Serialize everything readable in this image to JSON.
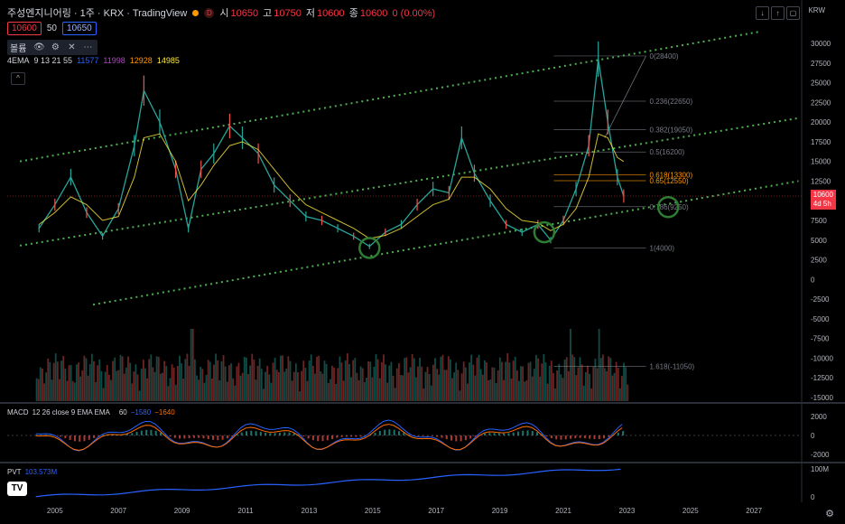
{
  "header": {
    "title": "주성엔지니어링 · 1주 · KRX · TradingView",
    "badge": "D",
    "ohlc": [
      {
        "label": "시",
        "value": "10650"
      },
      {
        "label": "고",
        "value": "10750"
      },
      {
        "label": "저",
        "value": "10600"
      },
      {
        "label": "종",
        "value": "10600"
      }
    ],
    "change": "0 (0.00%)"
  },
  "trade": {
    "sell": "10600",
    "spread": "50",
    "buy": "10650"
  },
  "toolbar": {
    "label": "볼륨"
  },
  "ema": {
    "name": "4EMA",
    "params": "9 13 21 55",
    "values": [
      {
        "v": "11577",
        "color": "#2962ff"
      },
      {
        "v": "11998",
        "color": "#ab47bc"
      },
      {
        "v": "12928",
        "color": "#ff9800"
      },
      {
        "v": "14985",
        "color": "#ffeb3b"
      }
    ]
  },
  "currency": "KRW",
  "price_tag": {
    "price": "10600",
    "time": "4d 5h"
  },
  "y_axis": [
    "30000",
    "27500",
    "25000",
    "22500",
    "20000",
    "17500",
    "15000",
    "12500",
    "10000",
    "7500",
    "5000",
    "2500",
    "0",
    "-2500",
    "-5000",
    "-7500",
    "-10000",
    "-12500",
    "-15000"
  ],
  "fib_levels": [
    {
      "label": "0(28400)",
      "color": "#787b86"
    },
    {
      "label": "0.236(22650)",
      "color": "#787b86"
    },
    {
      "label": "0.382(19050)",
      "color": "#787b86"
    },
    {
      "label": "0.5(16200)",
      "color": "#787b86"
    },
    {
      "label": "0.618(13300)",
      "color": "#ff9800"
    },
    {
      "label": "0.65(12550)",
      "color": "#ff9800"
    },
    {
      "label": "0.786(9250)",
      "color": "#787b86"
    },
    {
      "label": "1(4000)",
      "color": "#787b86"
    },
    {
      "label": "1.618(-11050)",
      "color": "#787b86"
    }
  ],
  "macd": {
    "name": "MACD",
    "params": "12 26 close 9 EMA EMA",
    "hist": "60",
    "macd": "−1580",
    "signal": "−1640",
    "axis": [
      "2000",
      "0",
      "-2000"
    ]
  },
  "pvt": {
    "name": "PVT",
    "value": "103.573M",
    "axis": [
      "100M",
      "0"
    ]
  },
  "x_axis": [
    "2005",
    "2007",
    "2009",
    "2011",
    "2013",
    "2015",
    "2017",
    "2019",
    "2021",
    "2023",
    "2025",
    "2027"
  ],
  "chart_data": {
    "type": "line",
    "title": "주성엔지니어링 · 1주 · KRX",
    "x": [
      2004.5,
      2005,
      2005.5,
      2006,
      2006.5,
      2007,
      2007.5,
      2007.8,
      2008.3,
      2008.8,
      2009.2,
      2009.6,
      2010,
      2010.5,
      2010.9,
      2011.4,
      2011.9,
      2012.4,
      2012.9,
      2013.4,
      2013.9,
      2014.4,
      2014.9,
      2015.4,
      2015.9,
      2016.4,
      2016.9,
      2017.4,
      2017.8,
      2018.2,
      2018.7,
      2019.2,
      2019.7,
      2020.2,
      2020.6,
      2021,
      2021.4,
      2021.8,
      2022.1,
      2022.4,
      2022.7,
      2022.9
    ],
    "close": [
      6500,
      9500,
      13000,
      8500,
      5500,
      9000,
      17000,
      24000,
      20000,
      14000,
      6500,
      14000,
      16000,
      19500,
      18000,
      16000,
      12000,
      10000,
      8000,
      7500,
      6500,
      5500,
      4200,
      6000,
      7000,
      9500,
      11500,
      11000,
      18000,
      13500,
      10000,
      7000,
      6000,
      7000,
      5000,
      7500,
      11500,
      17000,
      28000,
      20000,
      13000,
      10600
    ],
    "ema55": [
      7000,
      8500,
      10500,
      9500,
      7500,
      8000,
      13000,
      18000,
      18500,
      15000,
      10000,
      12000,
      14500,
      17000,
      17500,
      16500,
      14000,
      11500,
      9500,
      8500,
      7500,
      6500,
      5200,
      5600,
      6500,
      8000,
      9500,
      10200,
      13000,
      13000,
      11500,
      9000,
      7500,
      7200,
      6200,
      7000,
      9000,
      13000,
      18500,
      18000,
      15500,
      14985
    ],
    "ylim": [
      -15000,
      30000
    ],
    "xlim": [
      2003.5,
      2028.5
    ]
  }
}
